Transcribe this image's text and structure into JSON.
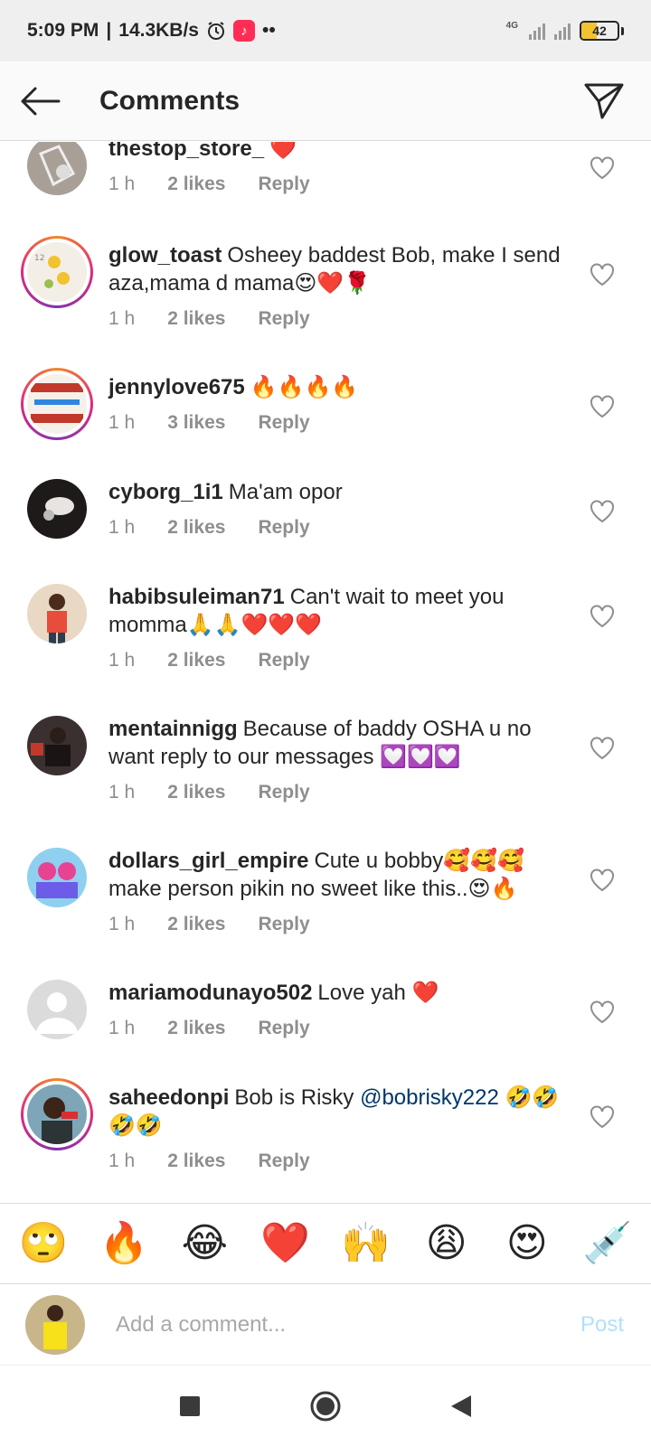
{
  "status_bar": {
    "time": "5:09 PM",
    "speed": "14.3KB/s",
    "network": "4G",
    "battery": "42",
    "battery_level": 0.42,
    "icons": [
      "alarm-icon",
      "tiktok-icon",
      "more-dots-icon",
      "signal-icon",
      "signal-icon",
      "battery-icon"
    ]
  },
  "header": {
    "title": "Comments",
    "back_icon": "back-arrow-icon",
    "share_icon": "send-icon"
  },
  "comments": [
    {
      "username": "thestop_store_",
      "text": "❤️",
      "time": "1 h",
      "likes": "2 likes",
      "reply": "Reply",
      "ring": false
    },
    {
      "username": "glow_toast",
      "text": "Osheey baddest Bob, make I send aza,mama d mama😍❤️🌹",
      "time": "1 h",
      "likes": "2 likes",
      "reply": "Reply",
      "ring": true
    },
    {
      "username": "jennylove675",
      "text": "🔥🔥🔥🔥",
      "time": "1 h",
      "likes": "3 likes",
      "reply": "Reply",
      "ring": true
    },
    {
      "username": "cyborg_1i1",
      "text": "Ma'am opor",
      "time": "1 h",
      "likes": "2 likes",
      "reply": "Reply",
      "ring": false
    },
    {
      "username": "habibsuleiman71",
      "text": "Can't wait to meet you momma🙏🙏❤️❤️❤️",
      "time": "1 h",
      "likes": "2 likes",
      "reply": "Reply",
      "ring": false
    },
    {
      "username": "mentainnigg",
      "text": "Because of baddy OSHA u no want reply to our messages 💟💟💟",
      "time": "1 h",
      "likes": "2 likes",
      "reply": "Reply",
      "ring": false
    },
    {
      "username": "dollars_girl_empire",
      "text": "Cute u bobby🥰🥰🥰 make person pikin no sweet like this..😍🔥",
      "time": "1 h",
      "likes": "2 likes",
      "reply": "Reply",
      "ring": false
    },
    {
      "username": "mariamodunayo502",
      "text": "Love yah ❤️",
      "time": "1 h",
      "likes": "2 likes",
      "reply": "Reply",
      "ring": false
    },
    {
      "username": "saheedonpi",
      "text": "Bob is Risky",
      "mention": "@bobrisky222",
      "text_after": "🤣🤣🤣🤣",
      "time": "1 h",
      "likes": "2 likes",
      "reply": "Reply",
      "ring": true
    }
  ],
  "emoji_bar": [
    "🙄",
    "🔥",
    "😂",
    "❤️",
    "🙌",
    "😩",
    "😍",
    "💉"
  ],
  "comment_input": {
    "placeholder": "Add a comment...",
    "post_label": "Post"
  },
  "nav": {
    "icons": [
      "recents-square-icon",
      "home-circle-icon",
      "back-triangle-icon"
    ]
  },
  "colors": {
    "accent_blue": "#0095f6",
    "post_disabled": "#b2dffc",
    "mention": "#00376b",
    "meta_gray": "#8e8e8e"
  }
}
